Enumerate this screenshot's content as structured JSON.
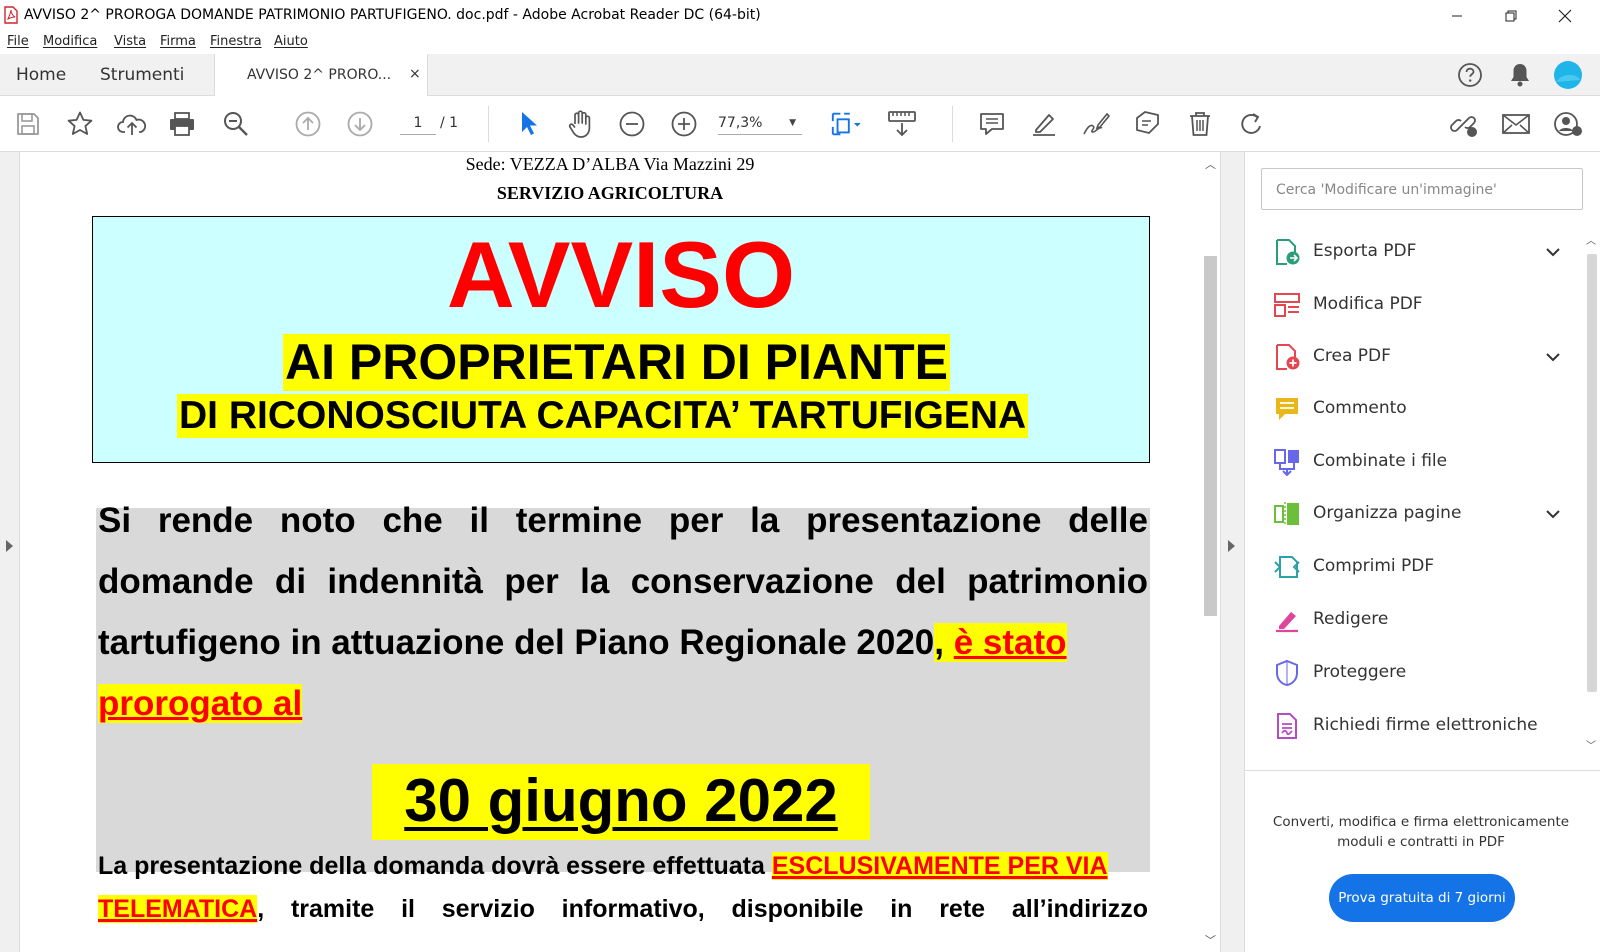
{
  "window": {
    "title": "AVVISO 2^ PROROGA DOMANDE PATRIMONIO PARTUFIGENO. doc.pdf - Adobe Acrobat Reader DC (64-bit)"
  },
  "menu": [
    "File",
    "Modifica",
    "Vista",
    "Firma",
    "Finestra",
    "Aiuto"
  ],
  "tabs": {
    "home": "Home",
    "strumenti": "Strumenti",
    "document": "AVVISO 2^ PRORO...",
    "close": "×"
  },
  "toolbar": {
    "page_current": "1",
    "page_total": "/ 1",
    "zoom": "77,3%"
  },
  "document": {
    "sede": "Sede: VEZZA D’ALBA  Via Mazzini 29",
    "servizio": "SERVIZIO AGRICOLTURA",
    "avviso_title": "AVVISO",
    "avviso_line1": "AI PROPRIETARI DI PIANTE",
    "avviso_line2": "DI RICONOSCIUTA CAPACITA’ TARTUFIGENA",
    "para_line1": [
      "Si",
      "rende",
      "noto",
      "che",
      "il",
      "termine",
      "per",
      "la",
      "presentazione",
      "delle"
    ],
    "para_line2": "domande di indennità per la conservazione del patrimonio",
    "para_line3_black": "tartufigeno in attuazione del Piano Regionale 2020",
    "para_line3_comma": ",",
    "para_line3_red": "è stato",
    "para_line4_red": "prorogato al",
    "date": "30 giugno 2022",
    "small_line1_black": "La presentazione della domanda dovrà essere effettuata",
    "small_line1_red": "ESCLUSIVAMENTE PER VIA",
    "small_line2_red": "TELEMATICA",
    "small_line2_rest": [
      ",",
      "tramite",
      "il",
      "servizio",
      "informativo,",
      "disponibile",
      "in",
      "rete",
      "all’indirizzo"
    ]
  },
  "tools_panel": {
    "search_placeholder": "Cerca 'Modificare un'immagine'",
    "items": [
      {
        "label": "Esporta PDF",
        "icon": "export-pdf-icon",
        "color": "#2d9d78",
        "expandable": true
      },
      {
        "label": "Modifica PDF",
        "icon": "edit-pdf-icon",
        "color": "#e34850",
        "expandable": false
      },
      {
        "label": "Crea PDF",
        "icon": "create-pdf-icon",
        "color": "#e34850",
        "expandable": true
      },
      {
        "label": "Commento",
        "icon": "comment-icon",
        "color": "#e8b718",
        "expandable": false
      },
      {
        "label": "Combinate i file",
        "icon": "combine-files-icon",
        "color": "#6767ec",
        "expandable": false
      },
      {
        "label": "Organizza pagine",
        "icon": "organize-pages-icon",
        "color": "#6cbf3a",
        "expandable": true
      },
      {
        "label": "Comprimi PDF",
        "icon": "compress-pdf-icon",
        "color": "#2da1a8",
        "expandable": false
      },
      {
        "label": "Redigere",
        "icon": "redact-icon",
        "color": "#e0449b",
        "expandable": false
      },
      {
        "label": "Proteggere",
        "icon": "protect-icon",
        "color": "#6767ec",
        "expandable": false
      },
      {
        "label": "Richiedi firme elettroniche",
        "icon": "request-signatures-icon",
        "color": "#b44cc4",
        "expandable": false
      }
    ],
    "promo_text": "Converti, modifica e firma elettronicamente moduli e contratti in PDF",
    "promo_button": "Prova gratuita di 7 giorni"
  },
  "colors": {
    "accent": "#1473e6",
    "highlight_yellow": "#ffff00",
    "alert_red": "#ff0000",
    "banner_cyan": "#ccffff"
  }
}
